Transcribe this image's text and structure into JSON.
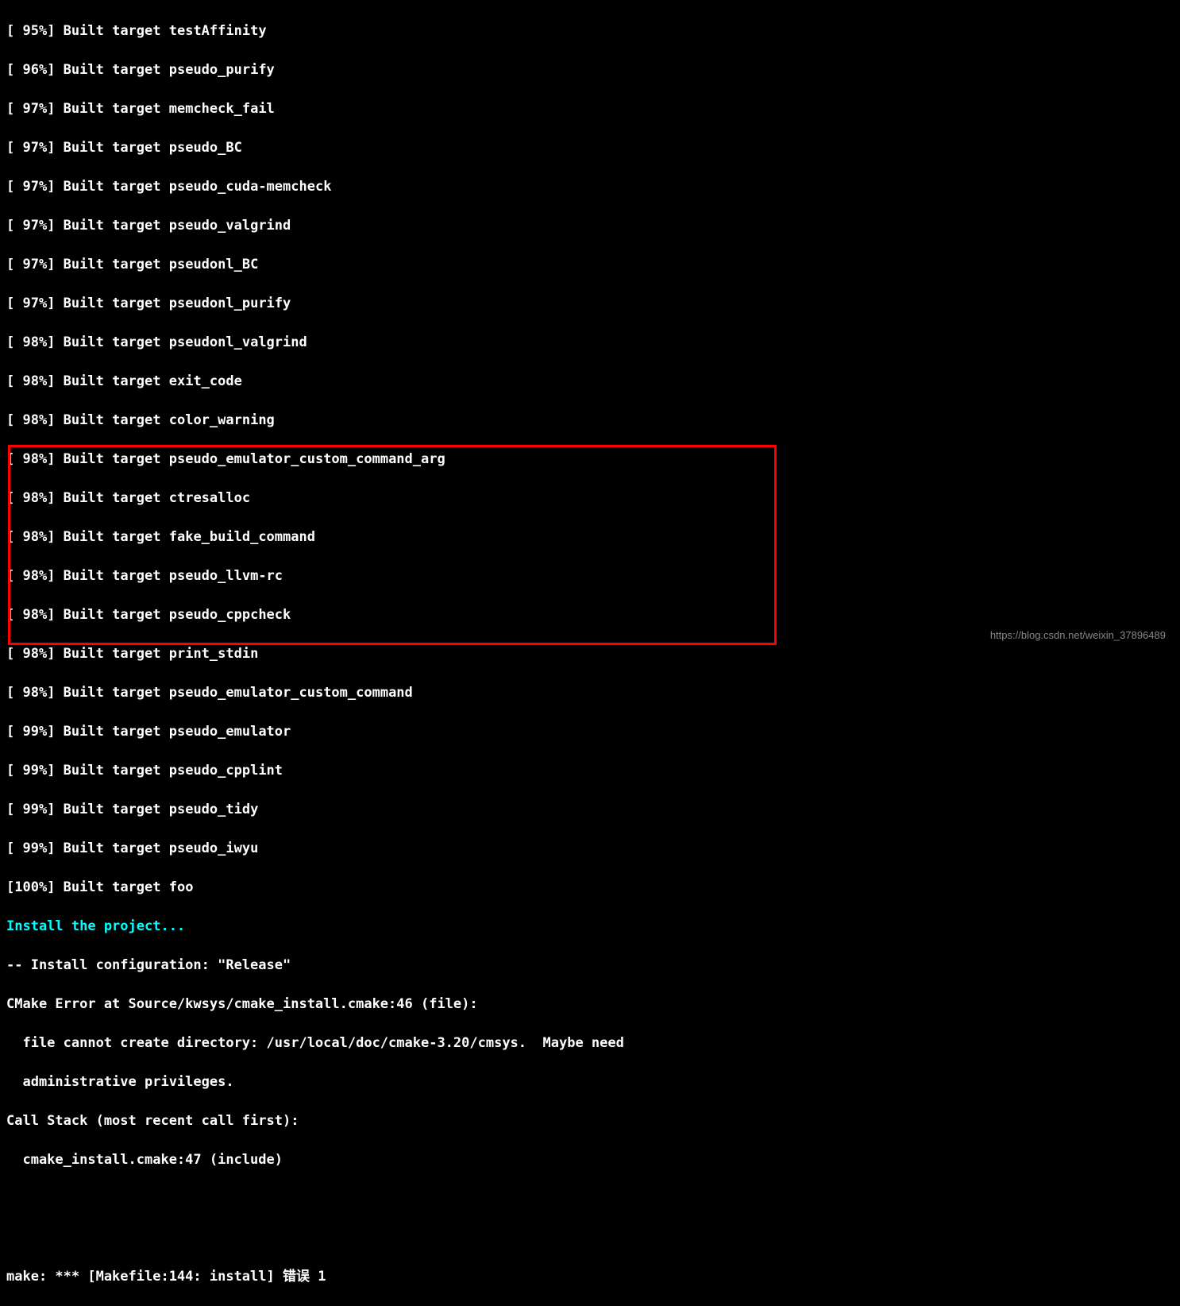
{
  "build_lines": [
    {
      "percent": "95",
      "target": "testAffinity"
    },
    {
      "percent": "96",
      "target": "pseudo_purify"
    },
    {
      "percent": "97",
      "target": "memcheck_fail"
    },
    {
      "percent": "97",
      "target": "pseudo_BC"
    },
    {
      "percent": "97",
      "target": "pseudo_cuda-memcheck"
    },
    {
      "percent": "97",
      "target": "pseudo_valgrind"
    },
    {
      "percent": "97",
      "target": "pseudonl_BC"
    },
    {
      "percent": "97",
      "target": "pseudonl_purify"
    },
    {
      "percent": "98",
      "target": "pseudonl_valgrind"
    },
    {
      "percent": "98",
      "target": "exit_code"
    },
    {
      "percent": "98",
      "target": "color_warning"
    },
    {
      "percent": "98",
      "target": "pseudo_emulator_custom_command_arg"
    },
    {
      "percent": "98",
      "target": "ctresalloc"
    },
    {
      "percent": "98",
      "target": "fake_build_command"
    },
    {
      "percent": "98",
      "target": "pseudo_llvm-rc"
    },
    {
      "percent": "98",
      "target": "pseudo_cppcheck"
    },
    {
      "percent": "98",
      "target": "print_stdin"
    },
    {
      "percent": "98",
      "target": "pseudo_emulator_custom_command"
    },
    {
      "percent": "99",
      "target": "pseudo_emulator"
    },
    {
      "percent": "99",
      "target": "pseudo_cpplint"
    },
    {
      "percent": "99",
      "target": "pseudo_tidy"
    },
    {
      "percent": "99",
      "target": "pseudo_iwyu"
    },
    {
      "percent": "100",
      "target": "foo"
    }
  ],
  "install_header": "Install the project...",
  "install_config": "-- Install configuration: \"Release\"",
  "error_lines": {
    "line1": "CMake Error at Source/kwsys/cmake_install.cmake:46 (file):",
    "line2": "  file cannot create directory: /usr/local/doc/cmake-3.20/cmsys.  Maybe need",
    "line3": "  administrative privileges.",
    "line4": "Call Stack (most recent call first):",
    "line5": "  cmake_install.cmake:47 (include)"
  },
  "make_error": "make: *** [Makefile:144: install] 错误 1",
  "watermark": "https://blog.csdn.net/weixin_37896489"
}
